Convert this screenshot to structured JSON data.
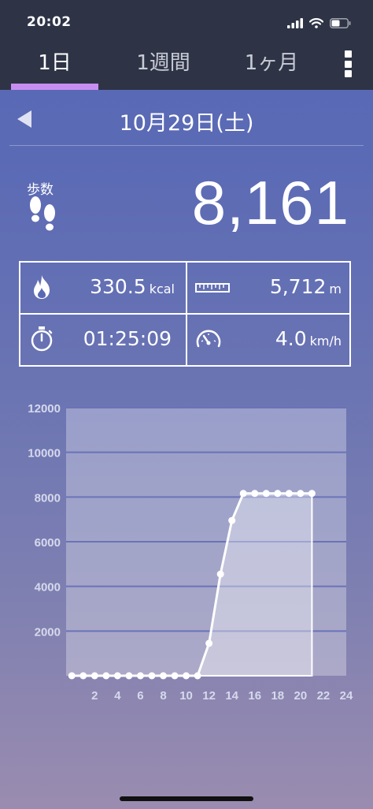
{
  "status_bar": {
    "time": "20:02",
    "icons": [
      "signal-icon",
      "wifi-icon",
      "battery-icon"
    ]
  },
  "tabs": [
    {
      "label": "1日",
      "active": true
    },
    {
      "label": "1週間",
      "active": false
    },
    {
      "label": "1ヶ月",
      "active": false
    }
  ],
  "menu": {
    "icon": "more-vertical-icon"
  },
  "date": {
    "label": "10月29日(土)",
    "prev_icon": "triangle-left-icon"
  },
  "steps": {
    "label": "歩数",
    "value": "8,161",
    "icon": "footprints-icon"
  },
  "stats": {
    "calories": {
      "value": "330.5",
      "unit": "kcal",
      "icon": "flame-icon"
    },
    "distance": {
      "value": "5,712",
      "unit": "m",
      "icon": "ruler-icon"
    },
    "duration": {
      "value": "01:25:09",
      "unit": "",
      "icon": "stopwatch-icon"
    },
    "speed": {
      "value": "4.0",
      "unit": "km/h",
      "icon": "speedometer-icon"
    }
  },
  "colors": {
    "status_bar_bg": "#2e3446",
    "tab_indicator": "#c78ef2",
    "background_top": "#5668b6",
    "background_bottom": "#9a8cb0"
  },
  "chart_data": {
    "type": "area",
    "x": [
      0,
      1,
      2,
      3,
      4,
      5,
      6,
      7,
      8,
      9,
      10,
      11,
      12,
      13,
      14,
      15,
      16,
      17,
      18,
      19,
      20,
      21
    ],
    "values": [
      0,
      0,
      0,
      0,
      0,
      0,
      0,
      0,
      0,
      0,
      0,
      0,
      1450,
      4550,
      6950,
      8161,
      8161,
      8161,
      8161,
      8161,
      8161,
      8161
    ],
    "x_ticks": [
      "2",
      "4",
      "6",
      "8",
      "10",
      "12",
      "14",
      "16",
      "18",
      "20",
      "22",
      "24"
    ],
    "y_ticks": [
      "12000",
      "10000",
      "8000",
      "6000",
      "4000",
      "2000"
    ],
    "xlim": [
      -0.5,
      24
    ],
    "ylim": [
      0,
      12000
    ],
    "grid": true
  }
}
